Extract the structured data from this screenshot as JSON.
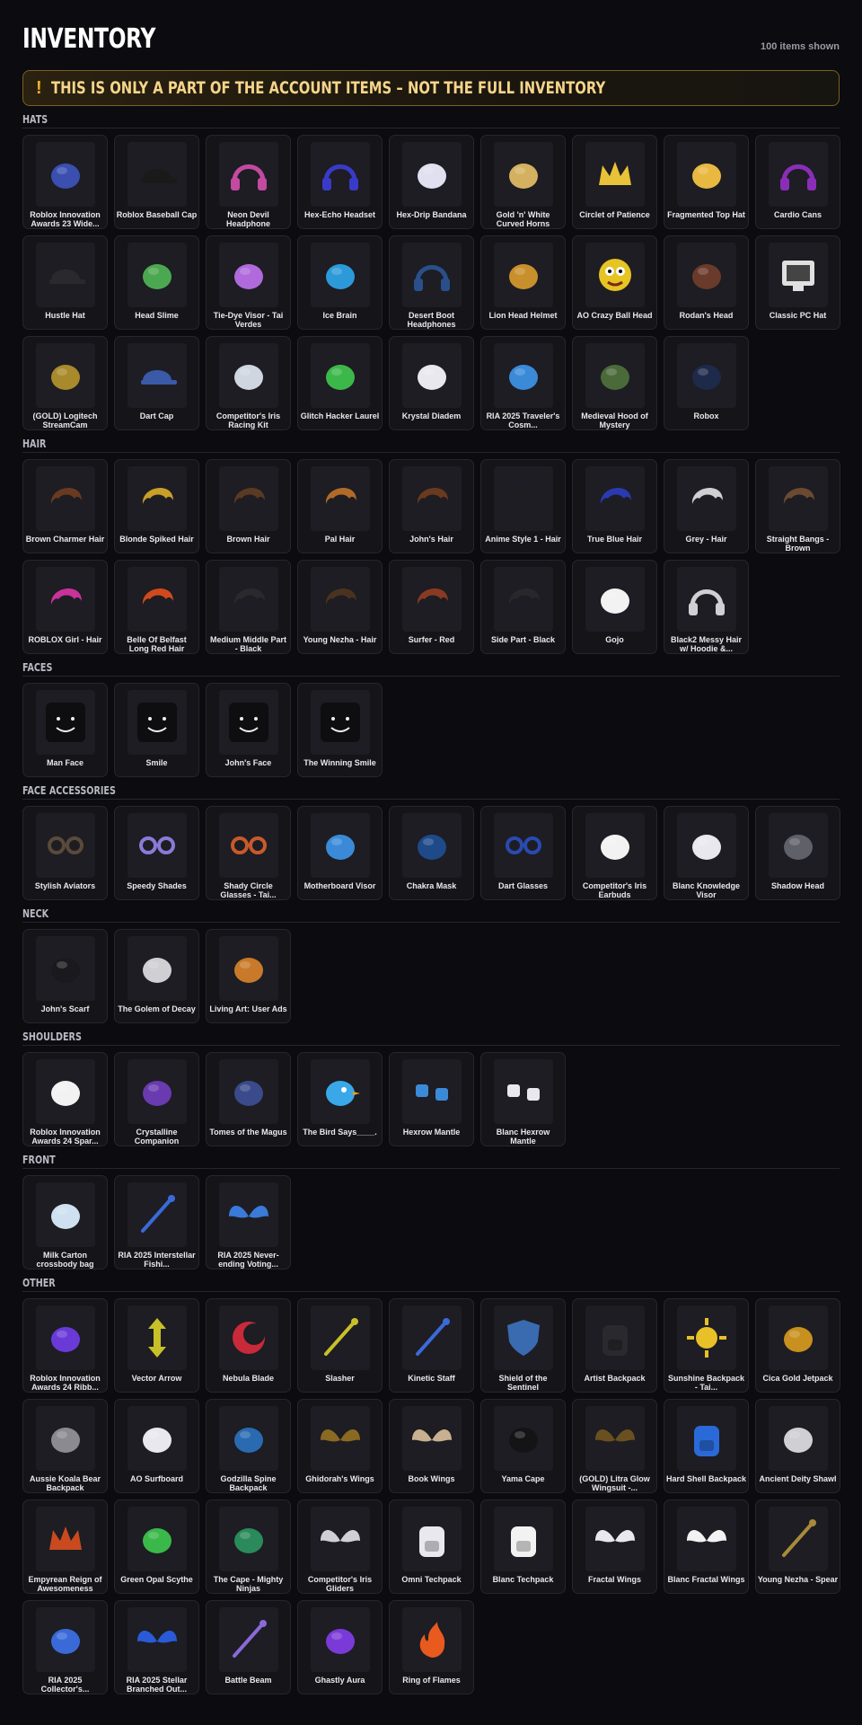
{
  "page": {
    "title": "INVENTORY",
    "count": "100 items shown",
    "banner": {
      "icon": "!",
      "text": "THIS IS ONLY A PART OF THE ACCOUNT ITEMS – NOT THE FULL INVENTORY"
    }
  },
  "sections": [
    {
      "title": "HATS",
      "items": [
        {
          "name": "Roblox Innovation Awards 23 Wide...",
          "icon": "hat-icon",
          "color": "#3a4fb0"
        },
        {
          "name": "Roblox Baseball Cap",
          "icon": "cap-icon",
          "color": "#1a1a1a"
        },
        {
          "name": "Neon Devil Headphone",
          "icon": "headphones-icon",
          "color": "#c24aa0"
        },
        {
          "name": "Hex-Echo Headset",
          "icon": "headphones-icon",
          "color": "#3a3ac8"
        },
        {
          "name": "Hex-Drip Bandana",
          "icon": "bandana-icon",
          "color": "#e0e0f0"
        },
        {
          "name": "Gold 'n' White Curved Horns",
          "icon": "horns-icon",
          "color": "#d4b160"
        },
        {
          "name": "Circlet of Patience",
          "icon": "crown-icon",
          "color": "#e8c238"
        },
        {
          "name": "Fragmented Top Hat",
          "icon": "tophat-icon",
          "color": "#e8b840"
        },
        {
          "name": "Cardio Cans",
          "icon": "headphones-icon",
          "color": "#8a2eb8"
        },
        {
          "name": "Hustle Hat",
          "icon": "cap-icon",
          "color": "#2a2a2e"
        },
        {
          "name": "Head Slime",
          "icon": "slime-icon",
          "color": "#4ca850"
        },
        {
          "name": "Tie-Dye Visor - Tai Verdes",
          "icon": "visor-icon",
          "color": "#b06adc"
        },
        {
          "name": "Ice Brain",
          "icon": "brain-icon",
          "color": "#2c9ad8"
        },
        {
          "name": "Desert Boot Headphones",
          "icon": "headphones-icon",
          "color": "#2a4f8a"
        },
        {
          "name": "Lion Head Helmet",
          "icon": "lion-icon",
          "color": "#c8902c"
        },
        {
          "name": "AO Crazy Ball Head",
          "icon": "face-ball-icon",
          "color": "#e6c422"
        },
        {
          "name": "Rodan's Head",
          "icon": "creature-icon",
          "color": "#6a3a2a"
        },
        {
          "name": "Classic PC Hat",
          "icon": "monitor-icon",
          "color": "#e0e0e0"
        },
        {
          "name": "(GOLD) Logitech StreamCam",
          "icon": "camera-icon",
          "color": "#a88a2c"
        },
        {
          "name": "Dart Cap",
          "icon": "cap-icon",
          "color": "#3a5aa8"
        },
        {
          "name": "Competitor's Iris Racing Kit",
          "icon": "goggles-icon",
          "color": "#cfd6e0"
        },
        {
          "name": "Glitch Hacker Laurel",
          "icon": "laurel-icon",
          "color": "#3cb84a"
        },
        {
          "name": "Krystal Diadem",
          "icon": "crystal-icon",
          "color": "#e8e8ee"
        },
        {
          "name": "RIA 2025 Traveler's Cosm...",
          "icon": "hat-icon",
          "color": "#3a8ad8"
        },
        {
          "name": "Medieval Hood of Mystery",
          "icon": "hood-icon",
          "color": "#4a6a3a"
        },
        {
          "name": "Robox",
          "icon": "box-icon",
          "color": "#1e2a4a"
        }
      ]
    },
    {
      "title": "HAIR",
      "items": [
        {
          "name": "Brown Charmer Hair",
          "icon": "hair-icon",
          "color": "#6a3a20"
        },
        {
          "name": "Blonde Spiked Hair",
          "icon": "hair-icon",
          "color": "#c8a028"
        },
        {
          "name": "Brown Hair",
          "icon": "hair-icon",
          "color": "#5a3a22"
        },
        {
          "name": "Pal Hair",
          "icon": "hair-icon",
          "color": "#b06a28"
        },
        {
          "name": "John's Hair",
          "icon": "hair-icon",
          "color": "#6a3a1e"
        },
        {
          "name": "Anime Style 1 - Hair",
          "icon": "hair-icon",
          "color": "#1e1e22"
        },
        {
          "name": "True Blue Hair",
          "icon": "hair-icon",
          "color": "#2a3ab0"
        },
        {
          "name": "Grey - Hair",
          "icon": "hair-icon",
          "color": "#cfcfd4"
        },
        {
          "name": "Straight Bangs - Brown",
          "icon": "hair-icon",
          "color": "#6a4a30"
        },
        {
          "name": "ROBLOX Girl - Hair",
          "icon": "hair-icon",
          "color": "#c8329a"
        },
        {
          "name": "Belle Of Belfast Long Red Hair",
          "icon": "hair-icon",
          "color": "#d04a1e"
        },
        {
          "name": "Medium Middle Part - Black",
          "icon": "hair-icon",
          "color": "#2a2a2e"
        },
        {
          "name": "Young Nezha - Hair",
          "icon": "hair-icon",
          "color": "#4a3220"
        },
        {
          "name": "Surfer - Red",
          "icon": "hair-icon",
          "color": "#8a3a22"
        },
        {
          "name": "Side Part - Black",
          "icon": "hair-icon",
          "color": "#28282c"
        },
        {
          "name": "Gojo",
          "icon": "head-icon",
          "color": "#f2f2f2"
        },
        {
          "name": "Black2 Messy Hair w/ Hoodie &...",
          "icon": "headphones-icon",
          "color": "#cfcfd4"
        }
      ]
    },
    {
      "title": "FACES",
      "items": [
        {
          "name": "Man Face",
          "icon": "face-icon",
          "color": "#000000"
        },
        {
          "name": "Smile",
          "icon": "face-icon",
          "color": "#000000"
        },
        {
          "name": "John's Face",
          "icon": "face-icon",
          "color": "#000000"
        },
        {
          "name": "The Winning Smile",
          "icon": "face-icon",
          "color": "#000000"
        }
      ]
    },
    {
      "title": "FACE ACCESSORIES",
      "items": [
        {
          "name": "Stylish Aviators",
          "icon": "glasses-icon",
          "color": "#5a4a3a"
        },
        {
          "name": "Speedy Shades",
          "icon": "glasses-icon",
          "color": "#8a7ad8"
        },
        {
          "name": "Shady Circle Glasses - Tai...",
          "icon": "glasses-icon",
          "color": "#c85a2a"
        },
        {
          "name": "Motherboard Visor",
          "icon": "visor-icon",
          "color": "#3a8ad8"
        },
        {
          "name": "Chakra Mask",
          "icon": "mask-icon",
          "color": "#1e4a8a"
        },
        {
          "name": "Dart Glasses",
          "icon": "glasses-icon",
          "color": "#2a4ab0"
        },
        {
          "name": "Competitor's Iris Earbuds",
          "icon": "earbuds-icon",
          "color": "#f2f2f2"
        },
        {
          "name": "Blanc Knowledge Visor",
          "icon": "visor-icon",
          "color": "#e8e8ee"
        },
        {
          "name": "Shadow Head",
          "icon": "head-icon",
          "color": "#606068"
        }
      ]
    },
    {
      "title": "NECK",
      "items": [
        {
          "name": "John's Scarf",
          "icon": "scarf-icon",
          "color": "#1a1a1e"
        },
        {
          "name": "The Golem of Decay",
          "icon": "necklace-icon",
          "color": "#cfcfd4"
        },
        {
          "name": "Living Art: User Ads",
          "icon": "frame-icon",
          "color": "#c87a2a"
        }
      ]
    },
    {
      "title": "SHOULDERS",
      "items": [
        {
          "name": "Roblox Innovation Awards 24 Spar...",
          "icon": "badge-icon",
          "color": "#f2f2f2"
        },
        {
          "name": "Crystalline Companion",
          "icon": "creature-icon",
          "color": "#6a3ab0"
        },
        {
          "name": "Tomes of the Magus",
          "icon": "book-icon",
          "color": "#3a4a8a"
        },
        {
          "name": "The Bird Says____.",
          "icon": "bird-icon",
          "color": "#3aa8e8"
        },
        {
          "name": "Hexrow Mantle",
          "icon": "cube-icon",
          "color": "#3a8ad8"
        },
        {
          "name": "Blanc Hexrow Mantle",
          "icon": "cube-icon",
          "color": "#e8e8ee"
        }
      ]
    },
    {
      "title": "FRONT",
      "items": [
        {
          "name": "Milk Carton crossbody bag",
          "icon": "bag-icon",
          "color": "#cfe0f0"
        },
        {
          "name": "RIA 2025 Interstellar Fishi...",
          "icon": "rod-icon",
          "color": "#3a6ad8"
        },
        {
          "name": "RIA 2025 Never-ending Voting...",
          "icon": "wings-icon",
          "color": "#3a7ad8"
        }
      ]
    },
    {
      "title": "OTHER",
      "items": [
        {
          "name": "Roblox Innovation Awards 24 Ribb...",
          "icon": "badge-icon",
          "color": "#6a3ad8"
        },
        {
          "name": "Vector Arrow",
          "icon": "arrow-icon",
          "color": "#c8c028"
        },
        {
          "name": "Nebula Blade",
          "icon": "blade-icon",
          "color": "#c82a3a"
        },
        {
          "name": "Slasher",
          "icon": "sword-icon",
          "color": "#c8c028"
        },
        {
          "name": "Kinetic Staff",
          "icon": "staff-icon",
          "color": "#3a6ad8"
        },
        {
          "name": "Shield of the Sentinel",
          "icon": "shield-icon",
          "color": "#3a6ab0"
        },
        {
          "name": "Artist Backpack",
          "icon": "backpack-icon",
          "color": "#2a2a2e"
        },
        {
          "name": "Sunshine Backpack - Tai...",
          "icon": "sun-icon",
          "color": "#e8c028"
        },
        {
          "name": "Cica Gold Jetpack",
          "icon": "jetpack-icon",
          "color": "#c8901e"
        },
        {
          "name": "Aussie Koala Bear Backpack",
          "icon": "koala-icon",
          "color": "#8a8a90"
        },
        {
          "name": "AO Surfboard",
          "icon": "surfboard-icon",
          "color": "#e8e8ee"
        },
        {
          "name": "Godzilla Spine Backpack",
          "icon": "spine-icon",
          "color": "#2a6ab0"
        },
        {
          "name": "Ghidorah's Wings",
          "icon": "wings-icon",
          "color": "#8a6a22"
        },
        {
          "name": "Book Wings",
          "icon": "wings-icon",
          "color": "#c8b090"
        },
        {
          "name": "Yama Cape",
          "icon": "cape-icon",
          "color": "#141416"
        },
        {
          "name": "(GOLD) Litra Glow Wingsuit -...",
          "icon": "wings-icon",
          "color": "#6a5020"
        },
        {
          "name": "Hard Shell Backpack",
          "icon": "backpack-icon",
          "color": "#2a6ad8"
        },
        {
          "name": "Ancient Deity Shawl",
          "icon": "scarf-icon",
          "color": "#cfcfd4"
        },
        {
          "name": "Empyrean Reign of Awesomeness",
          "icon": "crown-icon",
          "color": "#c84a1e"
        },
        {
          "name": "Green Opal Scythe",
          "icon": "scythe-icon",
          "color": "#3ab84a"
        },
        {
          "name": "The Cape - Mighty Ninjas",
          "icon": "cape-icon",
          "color": "#2a8a5a"
        },
        {
          "name": "Competitor's Iris Gliders",
          "icon": "wings-icon",
          "color": "#cfcfd4"
        },
        {
          "name": "Omni Techpack",
          "icon": "backpack-icon",
          "color": "#e8e8ee"
        },
        {
          "name": "Blanc Techpack",
          "icon": "backpack-icon",
          "color": "#f2f2f2"
        },
        {
          "name": "Fractal Wings",
          "icon": "wings-icon",
          "color": "#e8e8ee"
        },
        {
          "name": "Blanc Fractal Wings",
          "icon": "wings-icon",
          "color": "#f2f2f2"
        },
        {
          "name": "Young Nezha - Spear",
          "icon": "spear-icon",
          "color": "#a88a3a"
        },
        {
          "name": "RIA 2025 Collector's...",
          "icon": "card-icon",
          "color": "#3a6ad8"
        },
        {
          "name": "RIA 2025 Stellar Branched Out...",
          "icon": "wings-icon",
          "color": "#2a5ad8"
        },
        {
          "name": "Battle Beam",
          "icon": "beam-icon",
          "color": "#8a6ad8"
        },
        {
          "name": "Ghastly Aura",
          "icon": "aura-icon",
          "color": "#7a3ad8"
        },
        {
          "name": "Ring of Flames",
          "icon": "flame-icon",
          "color": "#e85a1e"
        }
      ]
    }
  ]
}
